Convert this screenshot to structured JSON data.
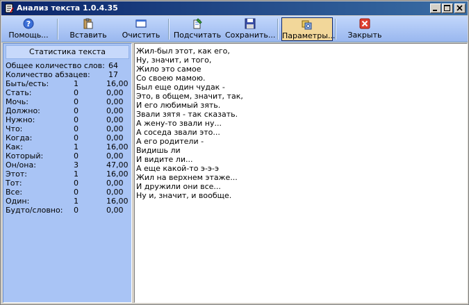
{
  "window": {
    "title": "Анализ текста 1.0.4.35"
  },
  "toolbar": {
    "buttons": [
      {
        "label": "Помощь...",
        "icon": "help-icon"
      },
      {
        "label": "Вставить",
        "icon": "paste-icon"
      },
      {
        "label": "Очистить",
        "icon": "clear-icon"
      },
      {
        "label": "Подсчитать",
        "icon": "count-icon"
      },
      {
        "label": "Сохранить...",
        "icon": "save-icon"
      },
      {
        "label": "Параметры...",
        "icon": "settings-icon"
      },
      {
        "label": "Закрыть",
        "icon": "close-icon"
      }
    ]
  },
  "stats": {
    "header": "Статистика текста",
    "summary": [
      {
        "label": "Общее количество слов:",
        "value": "64"
      },
      {
        "label": "Количество абзацев:",
        "value": "17"
      }
    ],
    "rows": [
      {
        "label": "Быть/есть:",
        "count": "1",
        "percent": "16,00"
      },
      {
        "label": "Стать:",
        "count": "0",
        "percent": "0,00"
      },
      {
        "label": "Мочь:",
        "count": "0",
        "percent": "0,00"
      },
      {
        "label": "Должно:",
        "count": "0",
        "percent": "0,00"
      },
      {
        "label": "Нужно:",
        "count": "0",
        "percent": "0,00"
      },
      {
        "label": "Что:",
        "count": "0",
        "percent": "0,00"
      },
      {
        "label": "Когда:",
        "count": "0",
        "percent": "0,00"
      },
      {
        "label": "Как:",
        "count": "1",
        "percent": "16,00"
      },
      {
        "label": "Который:",
        "count": "0",
        "percent": "0,00"
      },
      {
        "label": "Он/она:",
        "count": "3",
        "percent": "47,00"
      },
      {
        "label": "Этот:",
        "count": "1",
        "percent": "16,00"
      },
      {
        "label": "Тот:",
        "count": "0",
        "percent": "0,00"
      },
      {
        "label": "Все:",
        "count": "0",
        "percent": "0,00"
      },
      {
        "label": "Один:",
        "count": "1",
        "percent": "16,00"
      },
      {
        "label": "Будто/словно:",
        "count": "0",
        "percent": "0,00"
      }
    ]
  },
  "text": {
    "lines": [
      "Жил-был этот, как его,",
      "Ну, значит, и того,",
      "Жило это самое",
      "Со своею мамою.",
      "Был еще один чудак -",
      "Это, в общем, значит, так,",
      "И его любимый зять.",
      "Звали зятя - так сказать.",
      "А жену-то звали ну...",
      "А соседа звали это...",
      "А его родители -",
      "Видишь ли",
      "И видите ли...",
      "А еще какой-то э-э-э",
      "Жил на верхнем этаже...",
      "И дружили они все...",
      "Ну и, значит, и вообще."
    ]
  }
}
